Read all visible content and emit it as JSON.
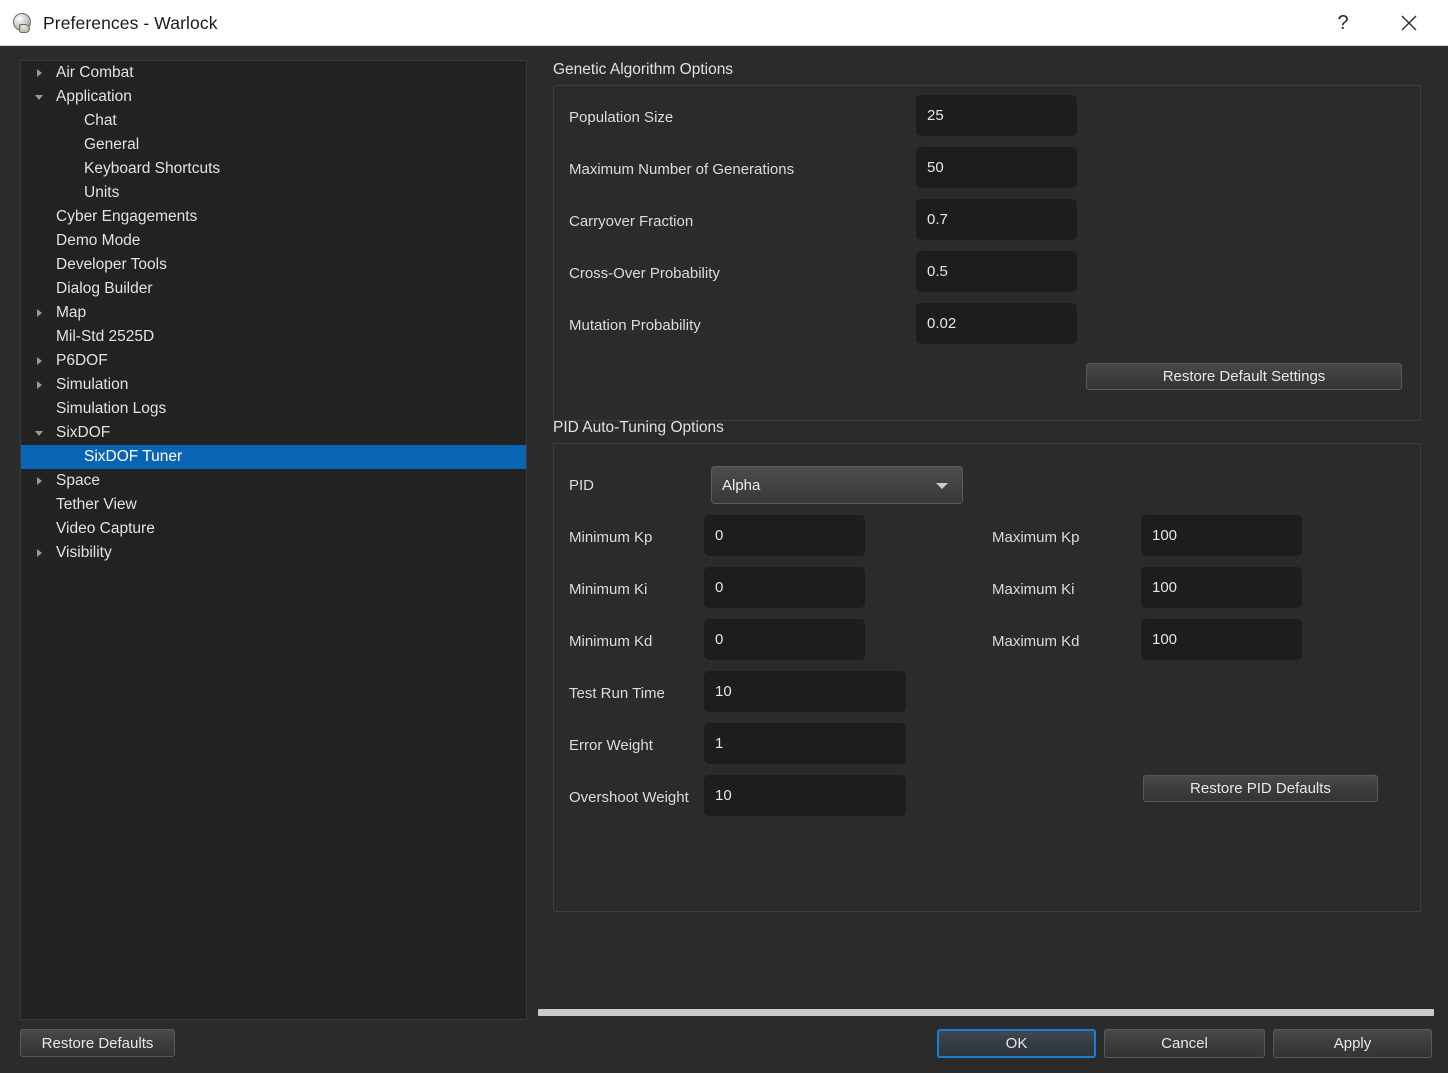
{
  "window": {
    "title": "Preferences - Warlock",
    "icon": "skull-icon",
    "help_label": "?",
    "close_label": "✕"
  },
  "tree": {
    "items": [
      {
        "label": "Air Combat",
        "level": 0,
        "arrow": "right"
      },
      {
        "label": "Application",
        "level": 0,
        "arrow": "down"
      },
      {
        "label": "Chat",
        "level": 1,
        "arrow": "none"
      },
      {
        "label": "General",
        "level": 1,
        "arrow": "none"
      },
      {
        "label": "Keyboard Shortcuts",
        "level": 1,
        "arrow": "none"
      },
      {
        "label": "Units",
        "level": 1,
        "arrow": "none"
      },
      {
        "label": "Cyber Engagements",
        "level": 0,
        "arrow": "none"
      },
      {
        "label": "Demo Mode",
        "level": 0,
        "arrow": "none"
      },
      {
        "label": "Developer Tools",
        "level": 0,
        "arrow": "none"
      },
      {
        "label": "Dialog Builder",
        "level": 0,
        "arrow": "none"
      },
      {
        "label": "Map",
        "level": 0,
        "arrow": "right"
      },
      {
        "label": "Mil-Std 2525D",
        "level": 0,
        "arrow": "none"
      },
      {
        "label": "P6DOF",
        "level": 0,
        "arrow": "right"
      },
      {
        "label": "Simulation",
        "level": 0,
        "arrow": "right"
      },
      {
        "label": "Simulation Logs",
        "level": 0,
        "arrow": "none"
      },
      {
        "label": "SixDOF",
        "level": 0,
        "arrow": "down"
      },
      {
        "label": "SixDOF Tuner",
        "level": 1,
        "arrow": "none",
        "selected": true
      },
      {
        "label": "Space",
        "level": 0,
        "arrow": "right"
      },
      {
        "label": "Tether View",
        "level": 0,
        "arrow": "none"
      },
      {
        "label": "Video Capture",
        "level": 0,
        "arrow": "none"
      },
      {
        "label": "Visibility",
        "level": 0,
        "arrow": "right"
      }
    ]
  },
  "genetic_algorithm": {
    "title": "Genetic Algorithm Options",
    "fields": [
      {
        "label": "Population Size",
        "value": "25"
      },
      {
        "label": "Maximum Number of Generations",
        "value": "50"
      },
      {
        "label": "Carryover Fraction",
        "value": "0.7"
      },
      {
        "label": "Cross-Over Probability",
        "value": "0.5"
      },
      {
        "label": "Mutation Probability",
        "value": "0.02"
      }
    ],
    "restore_button": "Restore Default Settings"
  },
  "pid": {
    "title": "PID Auto-Tuning Options",
    "pid_label": "PID",
    "pid_selected": "Alpha",
    "min_fields": [
      {
        "label": "Minimum Kp",
        "value": "0"
      },
      {
        "label": "Minimum Ki",
        "value": "0"
      },
      {
        "label": "Minimum Kd",
        "value": "0"
      }
    ],
    "max_fields": [
      {
        "label": "Maximum Kp",
        "value": "100"
      },
      {
        "label": "Maximum Ki",
        "value": "100"
      },
      {
        "label": "Maximum Kd",
        "value": "100"
      }
    ],
    "weight_fields": [
      {
        "label": "Test Run Time",
        "value": "10"
      },
      {
        "label": "Error Weight",
        "value": "1"
      },
      {
        "label": "Overshoot Weight",
        "value": "10"
      }
    ],
    "restore_button": "Restore PID Defaults"
  },
  "footer": {
    "restore_defaults": "Restore Defaults",
    "ok": "OK",
    "cancel": "Cancel",
    "apply": "Apply"
  },
  "colors": {
    "accent_selection": "#0a64b4",
    "focus_border": "#1581d6",
    "panel_bg": "#2b2b2b",
    "tree_bg": "#222222",
    "field_bg": "#1d1d1d"
  }
}
